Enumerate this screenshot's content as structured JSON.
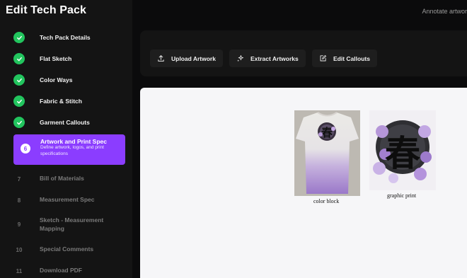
{
  "sidebar": {
    "title": "Edit Tech Pack",
    "steps": [
      {
        "label": "Tech Pack Details",
        "status": "done"
      },
      {
        "label": "Flat Sketch",
        "status": "done"
      },
      {
        "label": "Color Ways",
        "status": "done"
      },
      {
        "label": "Fabric & Stitch",
        "status": "done"
      },
      {
        "label": "Garment Callouts",
        "status": "done"
      },
      {
        "number": "6",
        "label": "Artwork and Print Spec",
        "description": "Define artwork, logos, and print specifications",
        "status": "active"
      },
      {
        "number": "7",
        "label": "Bill of Materials",
        "status": "upcoming"
      },
      {
        "number": "8",
        "label": "Measurement Spec",
        "status": "upcoming"
      },
      {
        "number": "9",
        "label": "Sketch - Measurement Mapping",
        "status": "upcoming"
      },
      {
        "number": "10",
        "label": "Special Comments",
        "status": "upcoming"
      },
      {
        "number": "11",
        "label": "Download PDF",
        "status": "upcoming"
      }
    ]
  },
  "header": {
    "right_text": "Annotate artwor"
  },
  "toolbar": {
    "upload_label": "Upload Artwork",
    "extract_label": "Extract Artworks",
    "edit_label": "Edit Callouts"
  },
  "canvas": {
    "items": [
      {
        "caption": "color block",
        "icon": "tshirt-image"
      },
      {
        "caption": "graphic print",
        "icon": "floral-graphic-image"
      }
    ]
  },
  "colors": {
    "accent": "#8b3dff",
    "done": "#22c55e",
    "sidebar_bg": "#141414",
    "canvas_bg": "#f6f6f8"
  }
}
